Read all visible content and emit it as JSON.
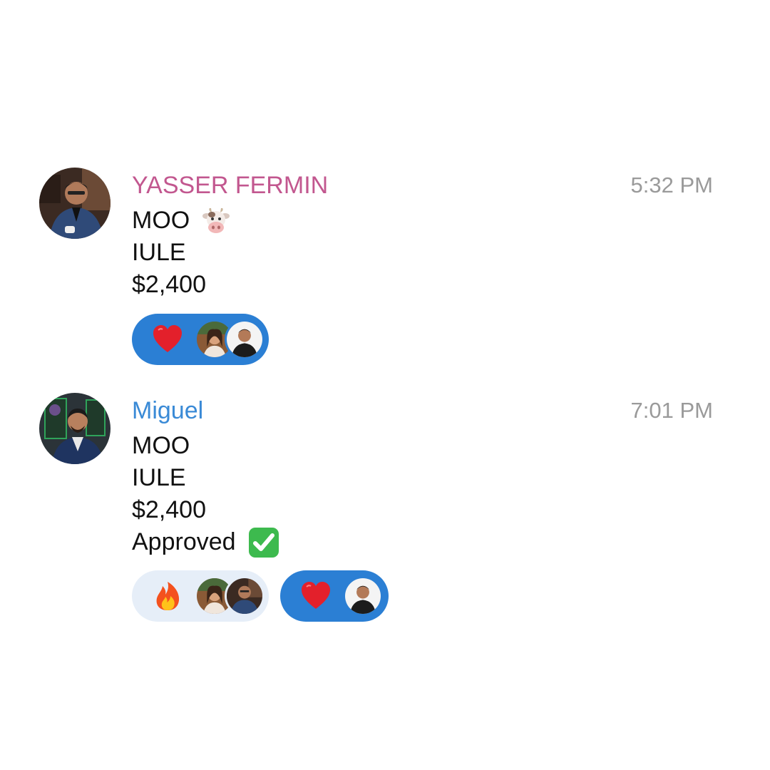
{
  "colors": {
    "yasser_name": "#c2578f",
    "miguel_name": "#3a8ad6",
    "active_reaction": "#2b7fd4",
    "inactive_reaction": "#e6eef8",
    "timestamp": "#9a9a9a"
  },
  "messages": [
    {
      "sender": "YASSER FERMIN",
      "time": "5:32 PM",
      "avatar_icon": "avatar-yasser-fermin",
      "lines": [
        "MOO",
        "IULE",
        "$2,400"
      ],
      "line_emoji": {
        "0": "cow-face-emoji"
      },
      "reactions": [
        {
          "emoji": "red-heart-emoji",
          "active": true,
          "reactors": 2
        }
      ]
    },
    {
      "sender": "Miguel",
      "time": "7:01 PM",
      "avatar_icon": "avatar-miguel",
      "lines": [
        "MOO",
        "IULE",
        "$2,400",
        "Approved"
      ],
      "line_emoji": {
        "3": "check-mark-button-emoji"
      },
      "reactions": [
        {
          "emoji": "fire-emoji",
          "active": false,
          "reactors": 2
        },
        {
          "emoji": "red-heart-emoji",
          "active": true,
          "reactors": 1
        }
      ]
    }
  ]
}
